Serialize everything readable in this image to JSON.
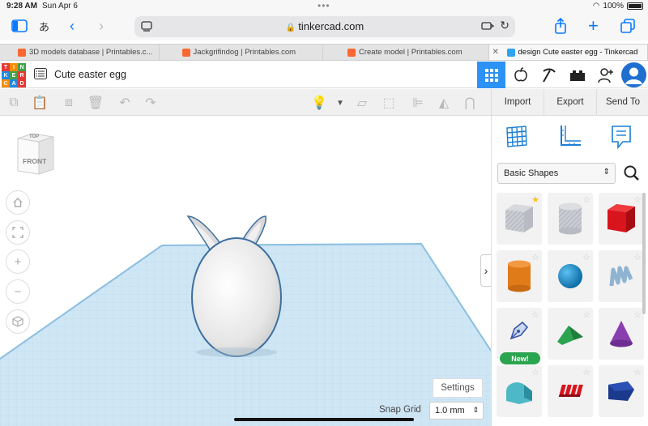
{
  "status": {
    "time": "9:28 AM",
    "date": "Sun Apr 6",
    "battery": "100%"
  },
  "browser": {
    "address": "tinkercad.com",
    "tabs": [
      {
        "label": "3D models database | Printables.c...",
        "active": false
      },
      {
        "label": "Jackgrifindog | Printables.com",
        "active": false
      },
      {
        "label": "Create model | Printables.com",
        "active": false
      },
      {
        "label": "design Cute easter egg - Tinkercad",
        "active": true
      }
    ]
  },
  "app": {
    "logo_letters": [
      "T",
      "I",
      "N",
      "K",
      "E",
      "R",
      "C",
      "A",
      "D"
    ],
    "design_title": "Cute easter egg"
  },
  "panel": {
    "import": "Import",
    "export": "Export",
    "send_to": "Send To",
    "shape_category": "Basic Shapes",
    "new_badge": "New!",
    "shapes": [
      {
        "name": "box-striped",
        "favorite": true
      },
      {
        "name": "cylinder-striped",
        "favorite": false
      },
      {
        "name": "box",
        "favorite": false
      },
      {
        "name": "cylinder",
        "favorite": false
      },
      {
        "name": "sphere",
        "favorite": false
      },
      {
        "name": "scribble",
        "favorite": false
      },
      {
        "name": "shape-generator",
        "favorite": false,
        "badge": "New!"
      },
      {
        "name": "roof",
        "favorite": false
      },
      {
        "name": "cone",
        "favorite": false
      },
      {
        "name": "round-roof",
        "favorite": false
      },
      {
        "name": "text",
        "favorite": false
      },
      {
        "name": "polygon",
        "favorite": false
      }
    ]
  },
  "canvas": {
    "view_cube_top": "TOP",
    "view_cube_front": "FRONT",
    "settings": "Settings",
    "snap_grid_label": "Snap Grid",
    "snap_grid_value": "1.0 mm"
  },
  "colors": {
    "accent": "#2d92f5",
    "workplane": "#cfe6f5",
    "box_red": "#d8141c",
    "cylinder_orange": "#e07b1a",
    "sphere_blue": "#1a8fd1",
    "roof_green": "#2aa44f",
    "cone_purple": "#8a3fb0",
    "polygon_navy": "#1c3a8c"
  }
}
